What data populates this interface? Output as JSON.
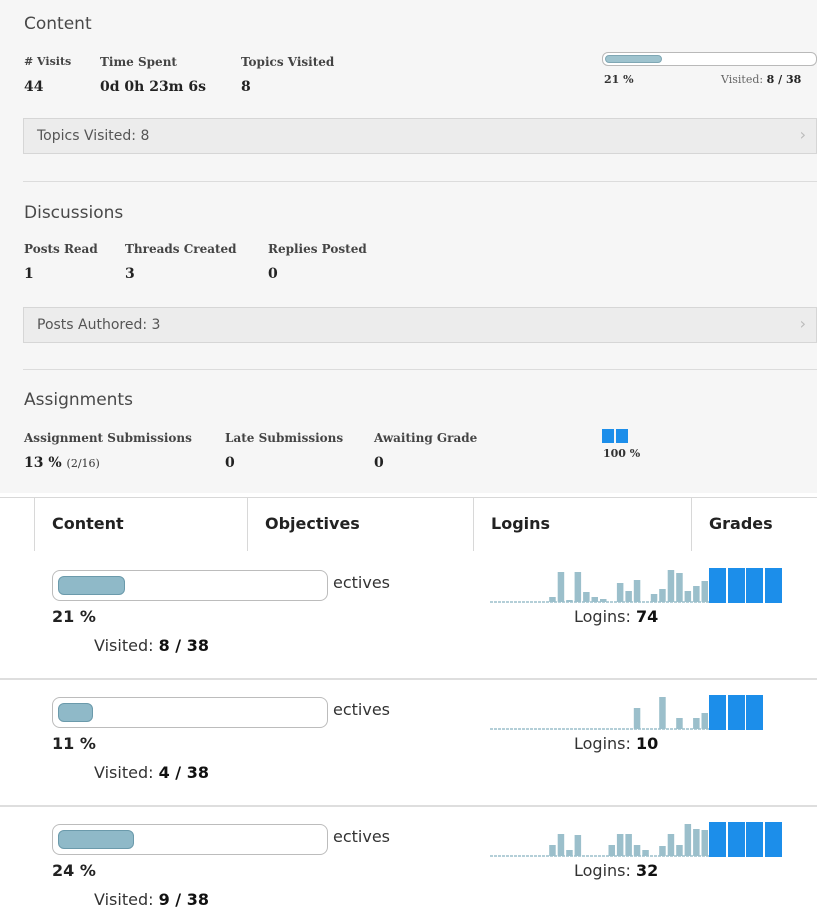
{
  "content_section": {
    "title": "Content",
    "stats": [
      {
        "label": "# Visits",
        "value": "44"
      },
      {
        "label": "Time Spent",
        "value": "0d 0h 23m 6s"
      },
      {
        "label": "Topics Visited",
        "value": "8"
      }
    ],
    "progress": {
      "percent_text": "21 %",
      "fraction": 0.21,
      "visited_label": "Visited:",
      "visited_value": "8 / 38"
    },
    "collapser": "Topics Visited: 8"
  },
  "discussions_section": {
    "title": "Discussions",
    "stats": [
      {
        "label": "Posts Read",
        "value": "1"
      },
      {
        "label": "Threads Created",
        "value": "3"
      },
      {
        "label": "Replies Posted",
        "value": "0"
      }
    ],
    "collapser": "Posts Authored: 3"
  },
  "assignments_section": {
    "title": "Assignments",
    "stats": [
      {
        "label": "Assignment Submissions",
        "value": "13 %",
        "sub": "(2/16)"
      },
      {
        "label": "Late Submissions",
        "value": "0"
      },
      {
        "label": "Awaiting Grade",
        "value": "0"
      }
    ],
    "grade_percent": "100 %"
  },
  "grid": {
    "headers": [
      "Content",
      "Objectives",
      "Logins",
      "Grades"
    ],
    "rows": [
      {
        "progress": 0.21,
        "percent_text": "21 %",
        "visited_label": "Visited:",
        "visited_value": "8 / 38",
        "objectives_text": "ectives",
        "logins_label": "Logins:",
        "logins_value": "74",
        "spark": [
          0,
          0,
          0,
          0,
          0,
          0,
          0,
          0.15,
          0.95,
          0.05,
          0.95,
          0.3,
          0.15,
          0.1,
          0,
          0.6,
          0.35,
          0.7,
          0,
          0.25,
          0.4,
          1.0,
          0.9,
          0.35,
          0.5,
          0.65
        ],
        "grades": 4
      },
      {
        "progress": 0.11,
        "percent_text": "11 %",
        "visited_label": "Visited:",
        "visited_value": "4 / 38",
        "objectives_text": "ectives",
        "logins_label": "Logins:",
        "logins_value": "10",
        "spark": [
          0,
          0,
          0,
          0,
          0,
          0,
          0,
          0,
          0,
          0,
          0,
          0,
          0,
          0,
          0,
          0,
          0,
          0.65,
          0,
          0,
          1.0,
          0,
          0.35,
          0,
          0.35,
          0.5
        ],
        "grades": 3
      },
      {
        "progress": 0.24,
        "percent_text": "24 %",
        "visited_label": "Visited:",
        "visited_value": "9 / 38",
        "objectives_text": "ectives",
        "logins_label": "Logins:",
        "logins_value": "32",
        "spark": [
          0,
          0,
          0,
          0,
          0,
          0,
          0,
          0.35,
          0.7,
          0.2,
          0.65,
          0,
          0,
          0,
          0.35,
          0.7,
          0.7,
          0.35,
          0.2,
          0,
          0.3,
          0.7,
          0.35,
          1.0,
          0.85,
          0.8
        ],
        "grades": 4
      }
    ]
  },
  "colors": {
    "accent": "#1c8eea",
    "spark": "#9bbfcb",
    "progress_fill": "#8fb9c8"
  }
}
